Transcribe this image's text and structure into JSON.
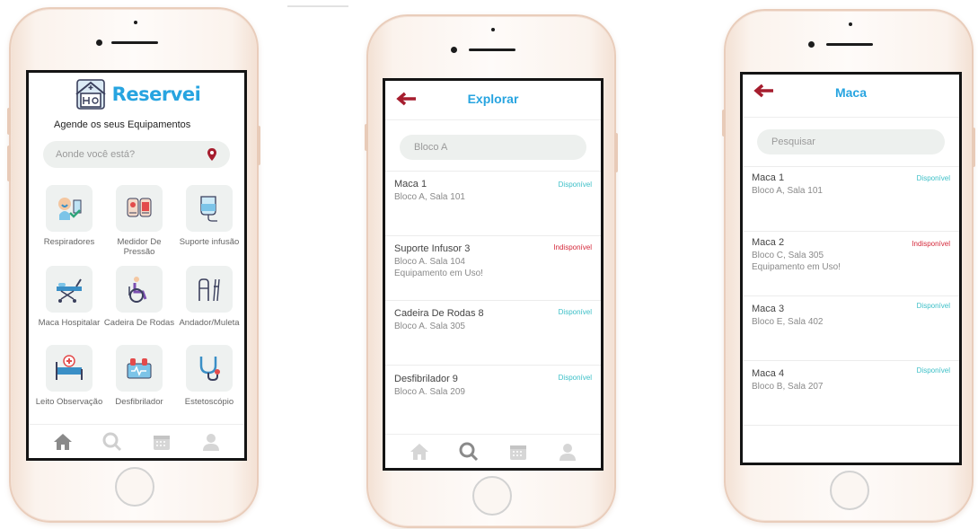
{
  "colors": {
    "accent": "#27a4e0",
    "brand_red": "#a61d2e",
    "available": "#3bbfc7",
    "unavailable": "#d4283a"
  },
  "screen_home": {
    "logo_text": "Reservei",
    "subtitle": "Agende os seus Equipamentos",
    "search_placeholder": "Aonde você está?",
    "categories": [
      {
        "label": "Respiradores",
        "icon": "respirator-icon"
      },
      {
        "label": "Medidor De Pressão",
        "icon": "blood-pressure-icon"
      },
      {
        "label": "Suporte infusão",
        "icon": "iv-bag-icon"
      },
      {
        "label": "Maca Hospitalar",
        "icon": "stretcher-icon"
      },
      {
        "label": "Cadeira De Rodas",
        "icon": "wheelchair-icon"
      },
      {
        "label": "Andador/Muleta",
        "icon": "walker-icon"
      },
      {
        "label": "Leito Observação",
        "icon": "hospital-bed-icon"
      },
      {
        "label": "Desfibrilador",
        "icon": "defibrillator-icon"
      },
      {
        "label": "Estetoscópio",
        "icon": "stethoscope-icon"
      }
    ],
    "tabs": [
      "home-icon",
      "search-icon",
      "calendar-icon",
      "profile-icon"
    ]
  },
  "screen_explore": {
    "title": "Explorar",
    "search_value": "Bloco A",
    "items": [
      {
        "name": "Maca 1",
        "location": "Bloco A, Sala 101",
        "note": "",
        "status": "Disponível",
        "available": true
      },
      {
        "name": "Suporte Infusor 3",
        "location": "Bloco A. Sala 104",
        "note": "Equipamento em Uso!",
        "status": "Indisponível",
        "available": false
      },
      {
        "name": "Cadeira De Rodas 8",
        "location": "Bloco A. Sala 305",
        "note": "",
        "status": "Disponível",
        "available": true
      },
      {
        "name": "Desfibrilador 9",
        "location": "Bloco A. Sala 209",
        "note": "",
        "status": "Disponível",
        "available": true
      }
    ]
  },
  "screen_maca": {
    "title": "Maca",
    "search_placeholder": "Pesquisar",
    "items": [
      {
        "name": "Maca 1",
        "location": "Bloco A, Sala 101",
        "note": "",
        "status": "Disponível",
        "available": true
      },
      {
        "name": "Maca 2",
        "location": "Bloco C, Sala 305",
        "note": "Equipamento em Uso!",
        "status": "Indisponível",
        "available": false
      },
      {
        "name": "Maca 3",
        "location": "Bloco E, Sala 402",
        "note": "",
        "status": "Disponível",
        "available": true
      },
      {
        "name": "Maca 4",
        "location": "Bloco B, Sala 207",
        "note": "",
        "status": "Disponível",
        "available": true
      }
    ]
  }
}
